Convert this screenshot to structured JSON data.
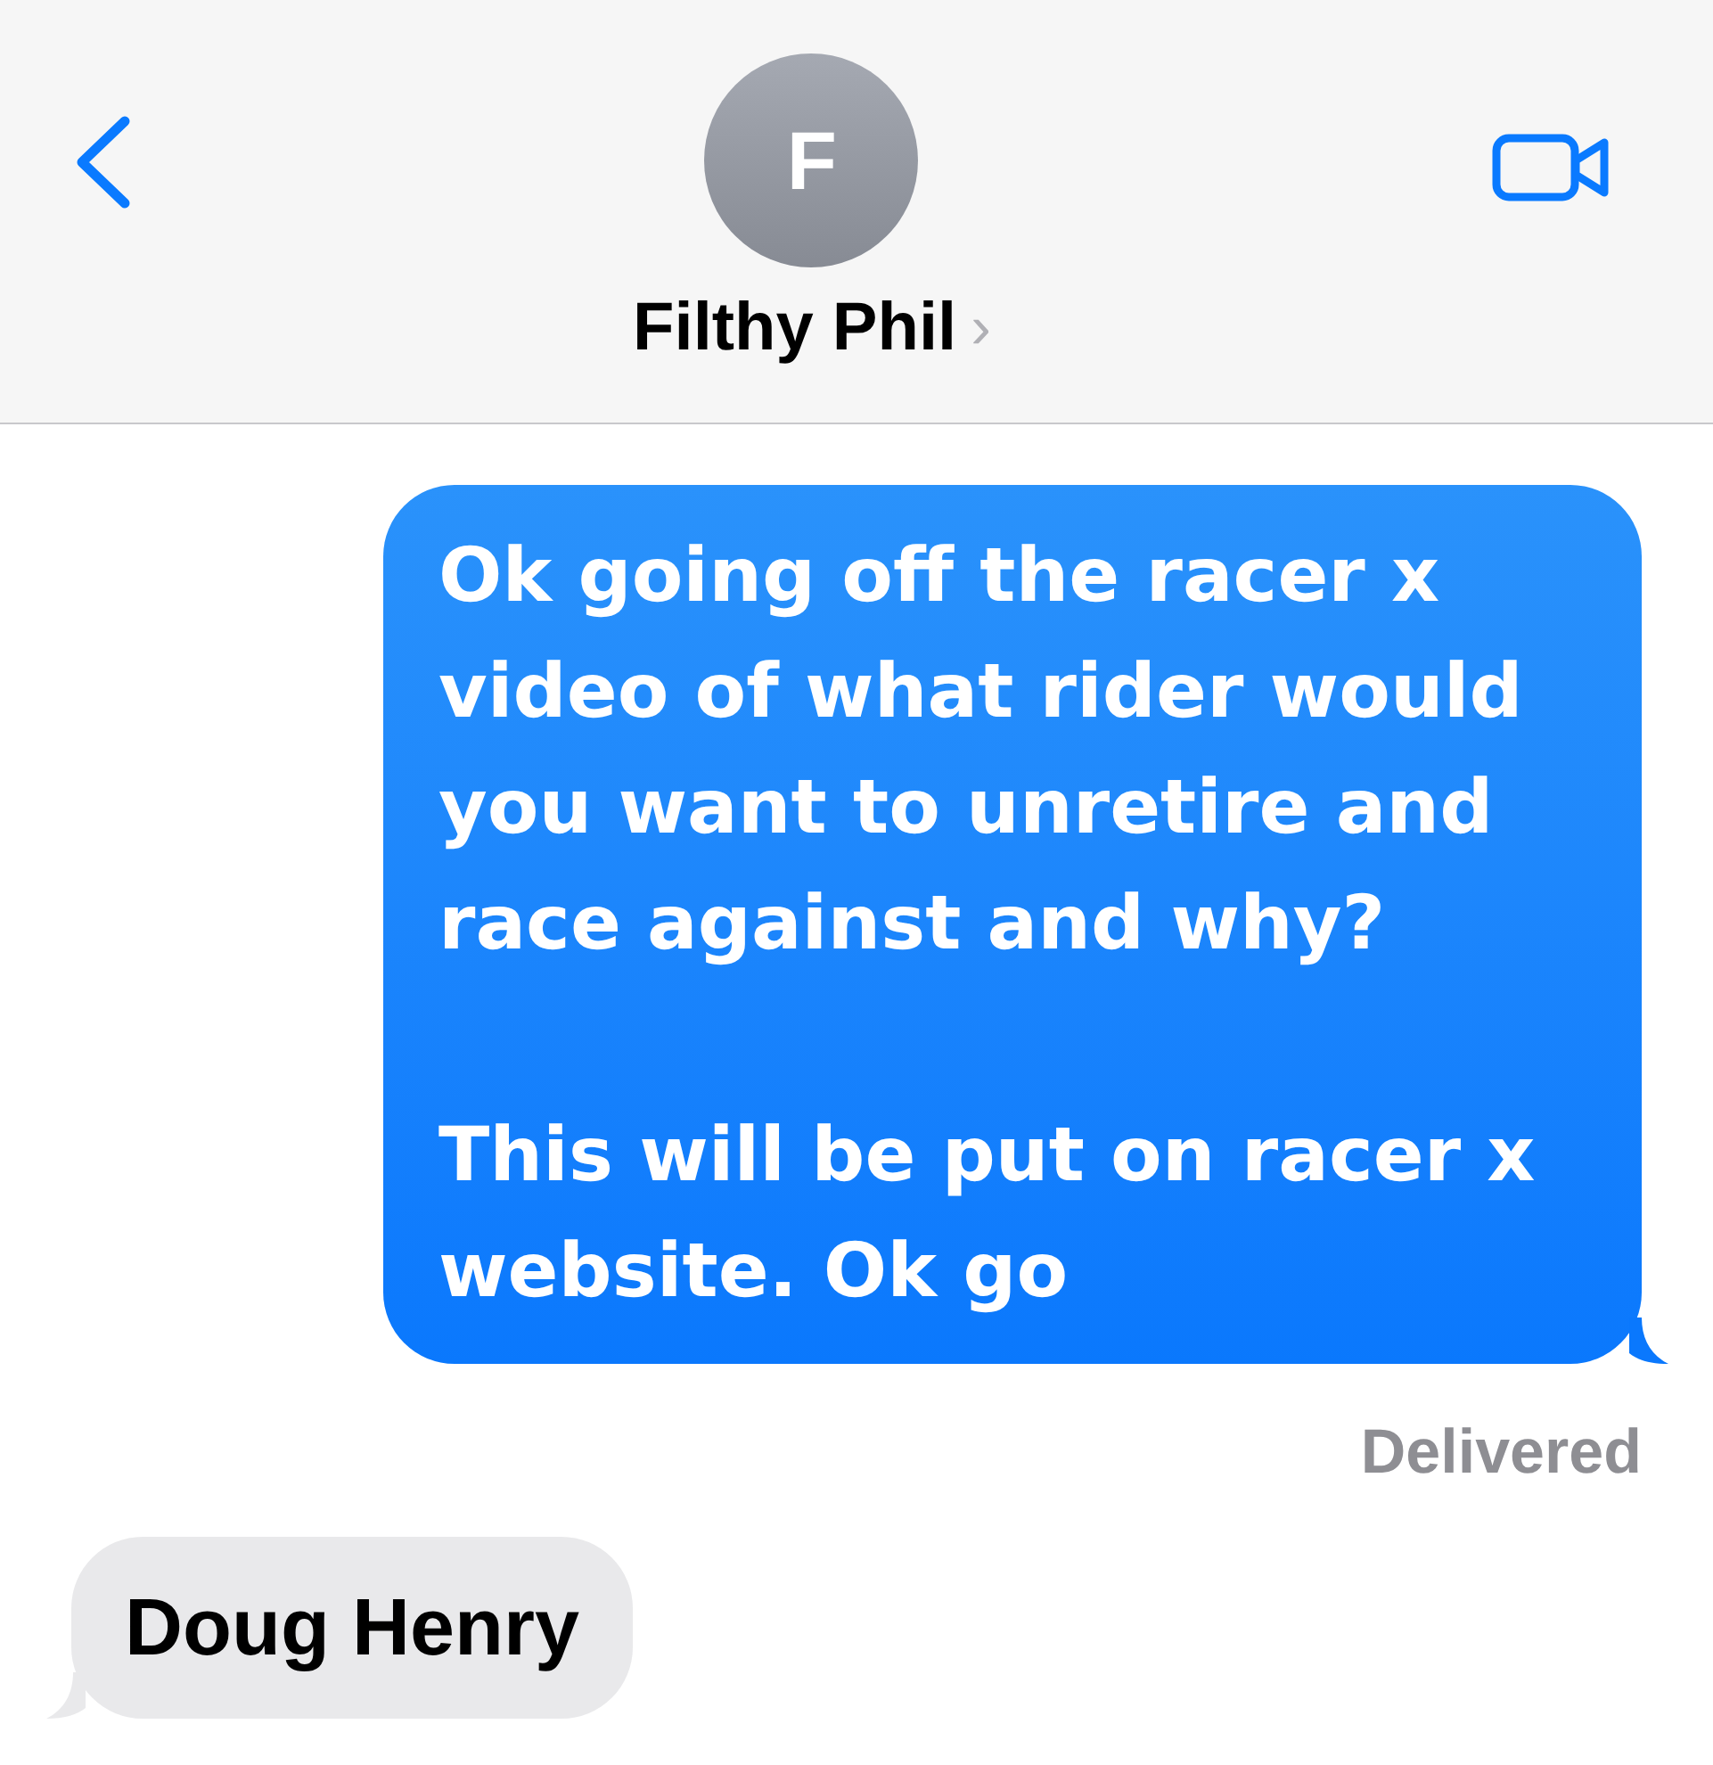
{
  "header": {
    "avatar_initial": "F",
    "contact_name": "Filthy Phil",
    "name_chevron": "›"
  },
  "messages": [
    {
      "kind": "sent",
      "text": "Ok going off the racer x video of what rider would you want to unretire and race against and why?\n\nThis will be put on racer x website. Ok go"
    },
    {
      "kind": "status",
      "text": "Delivered"
    },
    {
      "kind": "received",
      "text": "Doug Henry"
    }
  ]
}
